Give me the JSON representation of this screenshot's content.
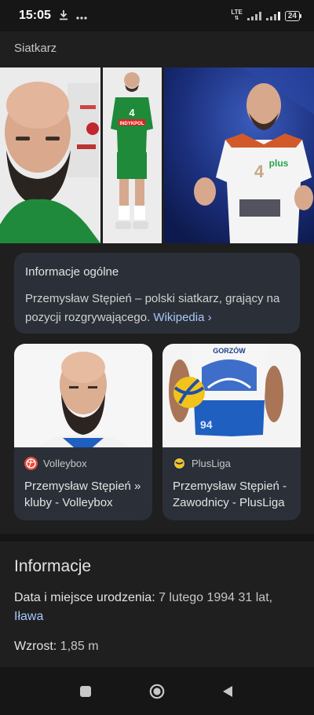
{
  "status_bar": {
    "time": "15:05",
    "network": "LTE",
    "battery": "24"
  },
  "header": {
    "subtitle": "Siatkarz"
  },
  "info_card": {
    "title": "Informacje ogólne",
    "text": "Przemysław Stępień – polski siatkarz, grający na pozycji rozgrywającego. ",
    "link": "Wikipedia",
    "link_chevron": "›"
  },
  "results": [
    {
      "source": "Volleybox",
      "title": "Przemysław Stępień » kluby - Volleybox"
    },
    {
      "source": "PlusLiga",
      "title": "Przemysław Stępień - Zawodnicy - PlusLiga"
    }
  ],
  "photos": {
    "jersey_number_small": "4",
    "sponsor_small": "INDYKPOL",
    "jersey_number_large": "4",
    "sponsor_large": "plus",
    "team_logo": "GORZÓW",
    "card_jersey_number": "94"
  },
  "details": {
    "heading": "Informacje",
    "birth_label": "Data i miejsce urodzenia:",
    "birth_value": " 7 lutego 1994 31 lat, ",
    "birth_place": "Iława",
    "height_label": "Wzrost:",
    "height_value": " 1,85 m"
  },
  "icons": {
    "download": "download-icon",
    "more": "more-dots-icon",
    "recents": "recents-icon",
    "home": "home-icon",
    "back": "back-icon"
  },
  "colors": {
    "background": "#1f1f1f",
    "card": "#2b3038",
    "link": "#a8c7fa",
    "text": "#e3e3e3"
  }
}
